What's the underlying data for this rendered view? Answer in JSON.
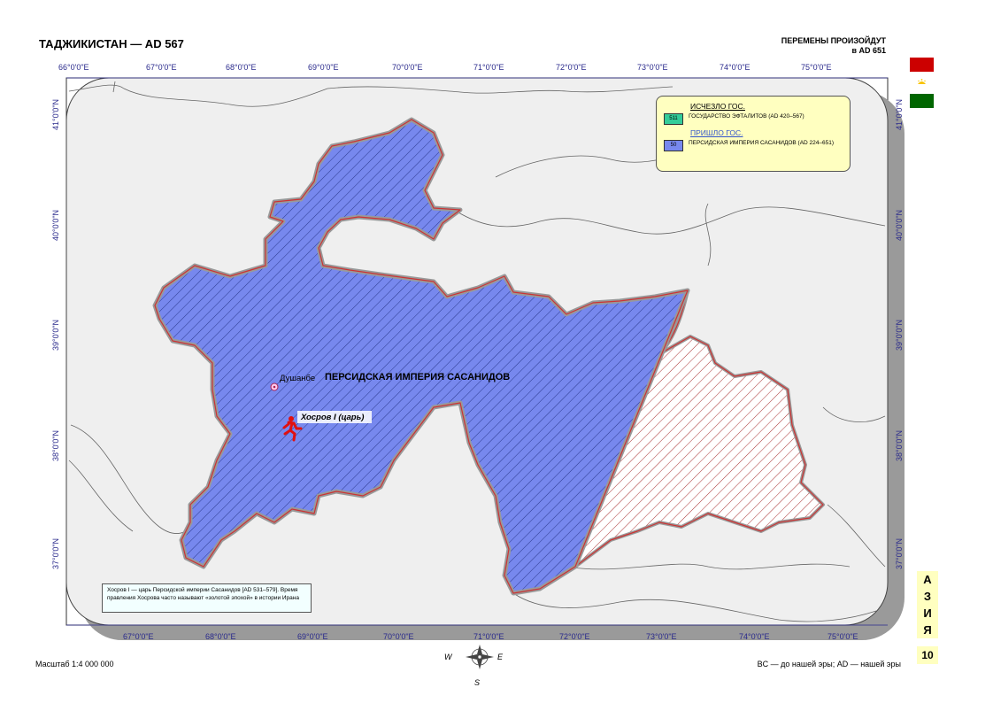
{
  "title": "ТАДЖИКИСТАН — AD 567",
  "changes": {
    "line1": "ПЕРЕМЕНЫ ПРОИЗОЙДУТ",
    "line2": "в AD 651"
  },
  "longitudes": [
    "66°0'0\"E",
    "67°0'0\"E",
    "68°0'0\"E",
    "69°0'0\"E",
    "70°0'0\"E",
    "71°0'0\"E",
    "72°0'0\"E",
    "73°0'0\"E",
    "74°0'0\"E",
    "75°0'0\"E"
  ],
  "latitudes": [
    "41°0'0\"N",
    "40°0'0\"N",
    "39°0'0\"N",
    "38°0'0\"N",
    "37°0'0\"N"
  ],
  "legend": {
    "gone_heading": "ИСЧЕЗЛО ГОС.",
    "gone_code": "511",
    "gone_label": "ГОСУДАРСТВО ЭФТАЛИТОВ (AD 420–567)",
    "came_heading": "ПРИШЛО ГОС.",
    "came_code": "50",
    "came_label": "ПЕРСИДСКАЯ ИМПЕРИЯ САСАНИДОВ (AD 224–651)",
    "gone_color": "#33cc99",
    "came_color": "#7788ee"
  },
  "map": {
    "city": "Душанбе",
    "empire_label": "ПЕРСИДСКАЯ ИМПЕРИЯ САСАНИДОВ",
    "ruler_label": "Хосров I (царь)",
    "empire_color": "#7788ee",
    "border_color": "#cc3333"
  },
  "note": "Хосров I — царь Персидской империи Сасанидов [AD 531–579]. Время правления Хосрова часто называют «золотой эпохой» в истории Ирана",
  "scale": "Масштаб 1:4 000 000",
  "era": "BC — до нашей эры; AD — нашей эры",
  "compass": {
    "w": "W",
    "e": "E",
    "s": "S"
  },
  "asia": [
    "А",
    "З",
    "И",
    "Я"
  ],
  "page_number": "10"
}
